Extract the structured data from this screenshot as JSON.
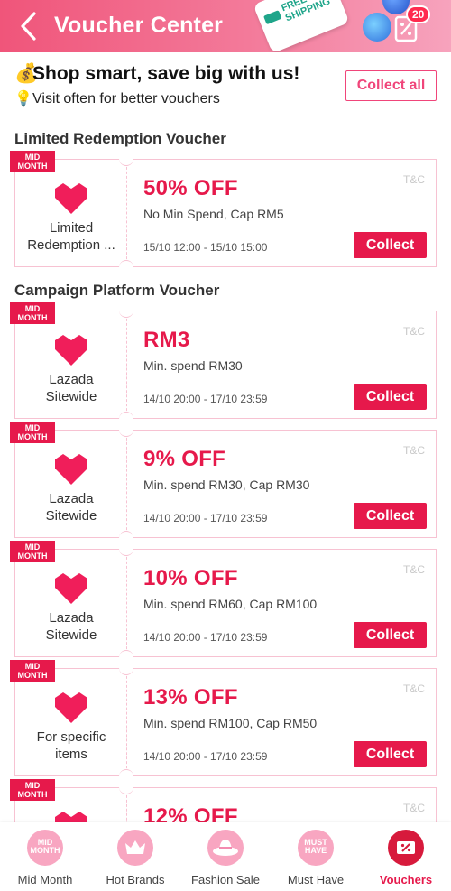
{
  "header": {
    "title": "Voucher Center",
    "shipping_banner": "FREE SHIPPING",
    "badge_count": "20"
  },
  "promo": {
    "line1": "Shop smart, save big with us!",
    "line2": "Visit often for better vouchers",
    "collect_all": "Collect all"
  },
  "sections": {
    "limited": "Limited Redemption Voucher",
    "campaign": "Campaign Platform Voucher"
  },
  "vouchers": [
    {
      "tag1": "MID",
      "tag2": "MONTH",
      "label1": "Limited",
      "label2": "Redemption ...",
      "amount": "50% OFF",
      "condition": "No Min Spend, Cap RM5",
      "date": "15/10 12:00 - 15/10 15:00",
      "tnc": "T&C",
      "button": "Collect"
    },
    {
      "tag1": "MID",
      "tag2": "MONTH",
      "label1": "Lazada",
      "label2": "Sitewide",
      "amount": "RM3",
      "condition": "Min. spend RM30",
      "date": "14/10 20:00 - 17/10 23:59",
      "tnc": "T&C",
      "button": "Collect"
    },
    {
      "tag1": "MID",
      "tag2": "MONTH",
      "label1": "Lazada",
      "label2": "Sitewide",
      "amount": "9% OFF",
      "condition": "Min. spend RM30, Cap RM30",
      "date": "14/10 20:00 - 17/10 23:59",
      "tnc": "T&C",
      "button": "Collect"
    },
    {
      "tag1": "MID",
      "tag2": "MONTH",
      "label1": "Lazada",
      "label2": "Sitewide",
      "amount": "10% OFF",
      "condition": "Min. spend RM60, Cap RM100",
      "date": "14/10 20:00 - 17/10 23:59",
      "tnc": "T&C",
      "button": "Collect"
    },
    {
      "tag1": "MID",
      "tag2": "MONTH",
      "label1": "For specific",
      "label2": "items",
      "amount": "13% OFF",
      "condition": "Min. spend RM100, Cap RM50",
      "date": "14/10 20:00 - 17/10 23:59",
      "tnc": "T&C",
      "button": "Collect"
    },
    {
      "tag1": "MID",
      "tag2": "MONTH",
      "amount": "12% OFF",
      "tnc": "T&C"
    }
  ],
  "bottom_nav": [
    {
      "label": "Mid Month",
      "icon_text1": "MID",
      "icon_text2": "MONTH",
      "icon": "mid-month-icon"
    },
    {
      "label": "Hot Brands",
      "icon": "crown-icon"
    },
    {
      "label": "Fashion Sale",
      "icon": "hat-icon"
    },
    {
      "label": "Must Have",
      "icon_text1": "MUST",
      "icon_text2": "HAVE",
      "icon": "must-have-icon"
    },
    {
      "label": "Vouchers",
      "icon": "voucher-icon",
      "active": true
    }
  ],
  "colors": {
    "brand": "#e6194b",
    "header_gradient_start": "#f0557a",
    "card_border": "#f7c2d2"
  }
}
